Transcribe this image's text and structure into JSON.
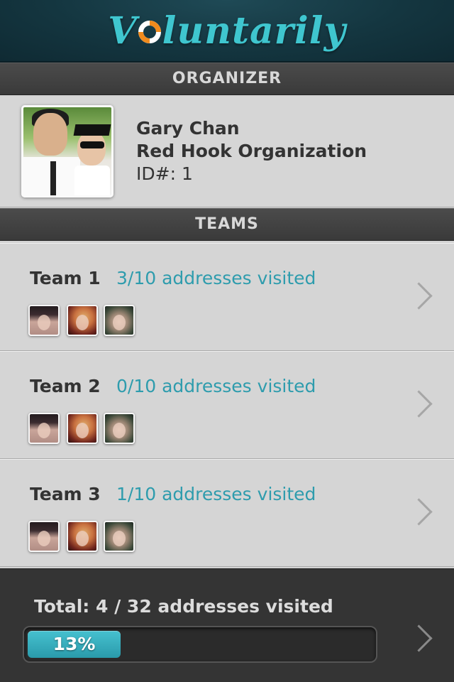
{
  "app": {
    "logo_lead": "V",
    "logo_rest": "luntarily",
    "logo_icon": "life-ring-icon",
    "accent_color": "#3fc6cf"
  },
  "organizer": {
    "section_title": "ORGANIZER",
    "name": "Gary Chan",
    "organization": "Red Hook Organization",
    "id_text": "ID#: 1"
  },
  "teams": {
    "section_title": "TEAMS",
    "items": [
      {
        "name": "Team 1",
        "visited": "3/10 addresses visited"
      },
      {
        "name": "Team 2",
        "visited": "0/10 addresses visited"
      },
      {
        "name": "Team 3",
        "visited": "1/10 addresses visited"
      }
    ]
  },
  "total": {
    "label": "Total: 4 / 32 addresses visited",
    "progress_text": "13%",
    "progress_fraction": 0.27
  }
}
